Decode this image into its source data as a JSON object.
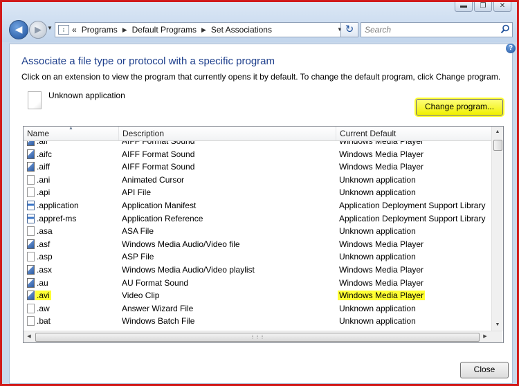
{
  "window": {
    "buttons": [
      {
        "name": "minimize-button",
        "glyph": "▬"
      },
      {
        "name": "maximize-button",
        "glyph": "❐"
      },
      {
        "name": "close-window-button",
        "glyph": "✕"
      }
    ]
  },
  "toolbar": {
    "back_icon": "back-arrow-icon",
    "forward_icon": "forward-arrow-icon",
    "overflow": "«",
    "breadcrumbs": [
      "Programs",
      "Default Programs",
      "Set Associations"
    ],
    "search_placeholder": "Search"
  },
  "main": {
    "title": "Associate a file type or protocol with a specific program",
    "description": "Click on an extension to view the program that currently opens it by default. To change the default program, click Change program.",
    "current_program": "Unknown application",
    "change_button": "Change program...",
    "close_button": "Close",
    "highlight_color": "#ffff33"
  },
  "table": {
    "columns": [
      "Name",
      "Description",
      "Current Default"
    ],
    "rows": [
      {
        "name": ".aif",
        "description": "AIFF Format Sound",
        "default": "Windows Media Player",
        "icon": "media"
      },
      {
        "name": ".aifc",
        "description": "AIFF Format Sound",
        "default": "Windows Media Player",
        "icon": "media"
      },
      {
        "name": ".aiff",
        "description": "AIFF Format Sound",
        "default": "Windows Media Player",
        "icon": "media"
      },
      {
        "name": ".ani",
        "description": "Animated Cursor",
        "default": "Unknown application",
        "icon": "doc"
      },
      {
        "name": ".api",
        "description": "API File",
        "default": "Unknown application",
        "icon": "doc"
      },
      {
        "name": ".application",
        "description": "Application Manifest",
        "default": "Application Deployment Support Library",
        "icon": "app"
      },
      {
        "name": ".appref-ms",
        "description": "Application Reference",
        "default": "Application Deployment Support Library",
        "icon": "app"
      },
      {
        "name": ".asa",
        "description": "ASA File",
        "default": "Unknown application",
        "icon": "doc"
      },
      {
        "name": ".asf",
        "description": "Windows Media Audio/Video file",
        "default": "Windows Media Player",
        "icon": "media"
      },
      {
        "name": ".asp",
        "description": "ASP File",
        "default": "Unknown application",
        "icon": "doc"
      },
      {
        "name": ".asx",
        "description": "Windows Media Audio/Video playlist",
        "default": "Windows Media Player",
        "icon": "media"
      },
      {
        "name": ".au",
        "description": "AU Format Sound",
        "default": "Windows Media Player",
        "icon": "media"
      },
      {
        "name": ".avi",
        "description": "Video Clip",
        "default": "Windows Media Player",
        "icon": "media",
        "highlight": true
      },
      {
        "name": ".aw",
        "description": "Answer Wizard File",
        "default": "Unknown application",
        "icon": "doc"
      },
      {
        "name": ".bat",
        "description": "Windows Batch File",
        "default": "Unknown application",
        "icon": "doc"
      }
    ]
  }
}
